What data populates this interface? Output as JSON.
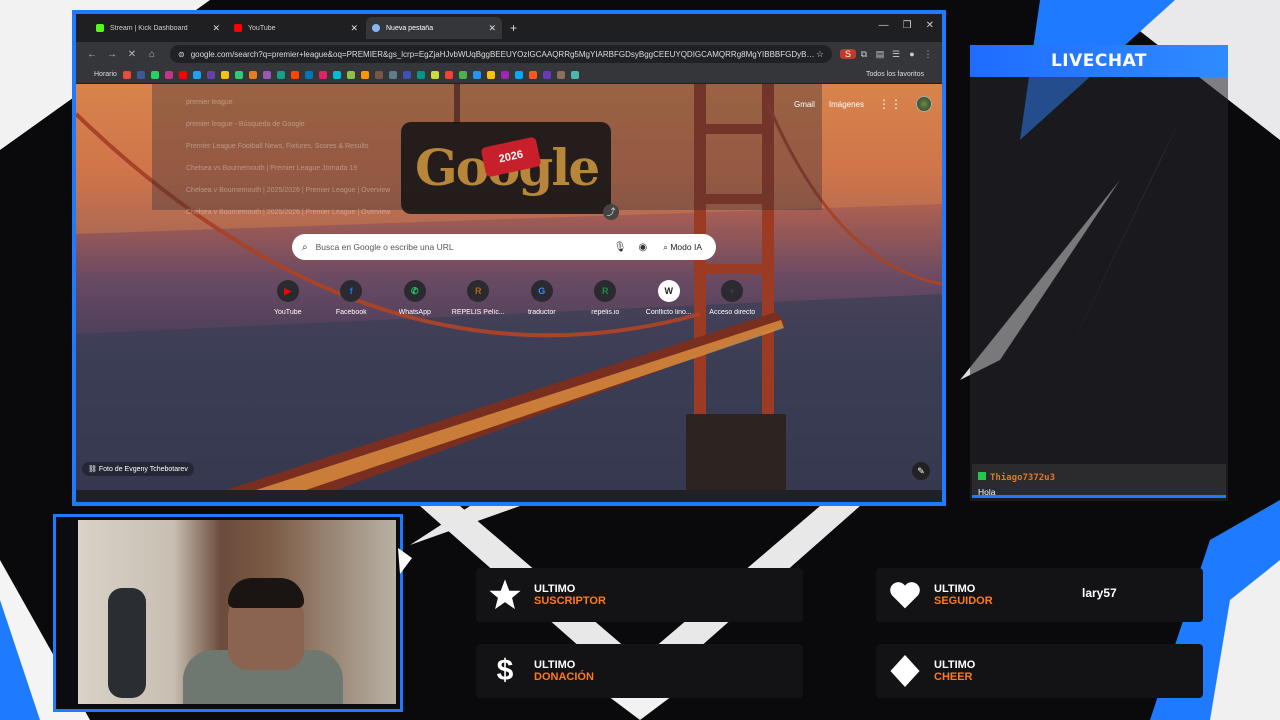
{
  "browser": {
    "tabs": [
      {
        "title": "Stream | Kick Dashboard",
        "icon": "kick-icon",
        "color": "#53fc18",
        "active": false
      },
      {
        "title": "YouTube",
        "icon": "youtube-icon",
        "color": "#ff0000",
        "active": false
      },
      {
        "title": "Nueva pestaña",
        "icon": "chrome-icon",
        "color": "#8ab4f8",
        "active": true
      }
    ],
    "url": "google.com/search?q=premier+league&oq=PREMIER&gs_lcrp=EgZjaHJvbWUqBggBEEUYOzIGCAAQRRg5MgYIARBFGDsyBggCEEUYQDIGCAMQRRg8MgYIBBBFGDyBggFLLU...",
    "bookmarks_first": "Horario",
    "bookmarks_all": "Todos los favoritos",
    "bookmark_colors": [
      "#e74c3c",
      "#3b5998",
      "#25d366",
      "#c13584",
      "#ff0000",
      "#1da1f2",
      "#6441a5",
      "#f1c40f",
      "#2ecc71",
      "#e67e22",
      "#9b59b6",
      "#16a085",
      "#ff4500",
      "#0077b5",
      "#e91e63",
      "#00bcd4",
      "#8bc34a",
      "#ff9800",
      "#795548",
      "#607d8b",
      "#3f51b5",
      "#009688",
      "#cddc39",
      "#f44336",
      "#4caf50",
      "#2196f3",
      "#ffc107",
      "#9c27b0",
      "#03a9f4",
      "#ff5722",
      "#673ab7",
      "#8d6e63",
      "#4db6ac"
    ]
  },
  "page": {
    "dropdown": [
      "premier league",
      "premier league - Búsqueda de Google",
      "Premier League Football News, Fixtures, Scores & Results",
      "Chelsea vs Bournemouth | Premier League Jornada 19",
      "Chelsea v Bournemouth | 2025/2026 | Premier League | Overview",
      "Chelsea v Bournemouth | 2025/2026 | Premier League | Overview"
    ],
    "doodle_text": "Google",
    "doodle_year": "2026",
    "gmail": "Gmail",
    "imagenes": "Imágenes",
    "search_placeholder": "Busca en Google o escribe una URL",
    "modo_ia": "Modo IA",
    "shortcuts": [
      {
        "label": "YouTube",
        "glyph": "▶",
        "color": "#ff0000"
      },
      {
        "label": "Facebook",
        "glyph": "f",
        "color": "#1877f2"
      },
      {
        "label": "WhatsApp",
        "glyph": "✆",
        "color": "#25d366"
      },
      {
        "label": "REPELIS Pelíc...",
        "glyph": "R",
        "color": "#b0641f"
      },
      {
        "label": "traductor",
        "glyph": "G",
        "color": "#4285f4"
      },
      {
        "label": "repelis.io",
        "glyph": "R",
        "color": "#1e8e3e"
      },
      {
        "label": "Conflicto lino...",
        "glyph": "W",
        "color": "#ffffff"
      },
      {
        "label": "Acceso directo",
        "glyph": "+",
        "color": "#3c4043"
      }
    ],
    "photo_credit": "Foto de Evgeny Tchebotarev"
  },
  "chat": {
    "header": "LIVECHAT",
    "username": "Thiago7372u3",
    "message": "Hola"
  },
  "alerts": [
    {
      "line1": "ULTIMO",
      "line2": "SUSCRIPTOR",
      "value": "",
      "icon": "star-icon"
    },
    {
      "line1": "ULTIMO",
      "line2": "SEGUIDOR",
      "value": "lary57",
      "icon": "heart-icon"
    },
    {
      "line1": "ULTIMO",
      "line2": "DONACIÓN",
      "value": "",
      "icon": "dollar-icon"
    },
    {
      "line1": "ULTIMO",
      "line2": "CHEER",
      "value": "",
      "icon": "diamond-icon"
    }
  ],
  "colors": {
    "accent": "#1e7bff",
    "alert": "#ff7a1a",
    "username": "#e8732a"
  }
}
